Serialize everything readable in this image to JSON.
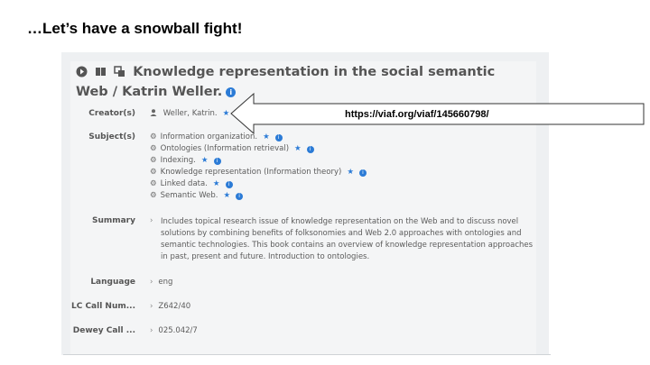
{
  "slide": {
    "title": "…Let’s have a snowball fight!"
  },
  "record": {
    "title": "Knowledge representation in the social semantic Web / Katrin Weller.",
    "info_icon_glyph": "i"
  },
  "fields": {
    "creator_label": "Creator(s)",
    "creator_value": "Weller, Katrin.",
    "subject_label": "Subject(s)",
    "subjects": [
      "Information organization.",
      "Ontologies (Information retrieval)",
      "Indexing.",
      "Knowledge representation (Information theory)",
      "Linked data.",
      "Semantic Web."
    ],
    "summary_label": "Summary",
    "summary_value": "Includes topical research issue of knowledge representation on the Web and to discuss novel solutions by combining benefits of folksonomies and Web 2.0 approaches with ontologies and semantic technologies. This book contains an overview of knowledge representation approaches in past, present and future. Introduction to ontologies.",
    "language_label": "Language",
    "language_value": "eng",
    "lc_label": "LC Call Num...",
    "lc_value": "Z642/40",
    "dewey_label": "Dewey Call ...",
    "dewey_value": "025.042/7"
  },
  "callout": {
    "url": "https://viaf.org/viaf/145660798/"
  },
  "icons": {
    "chevron": "chevron-right-icon",
    "person": "person-icon",
    "star": "star-icon",
    "info": "info-icon",
    "gear": "gear-icon",
    "book": "book-icon",
    "play": "play-circle-icon"
  },
  "colors": {
    "accent": "#2b7bd6",
    "panel": "#eef0f2",
    "text": "#5b5b5b"
  }
}
